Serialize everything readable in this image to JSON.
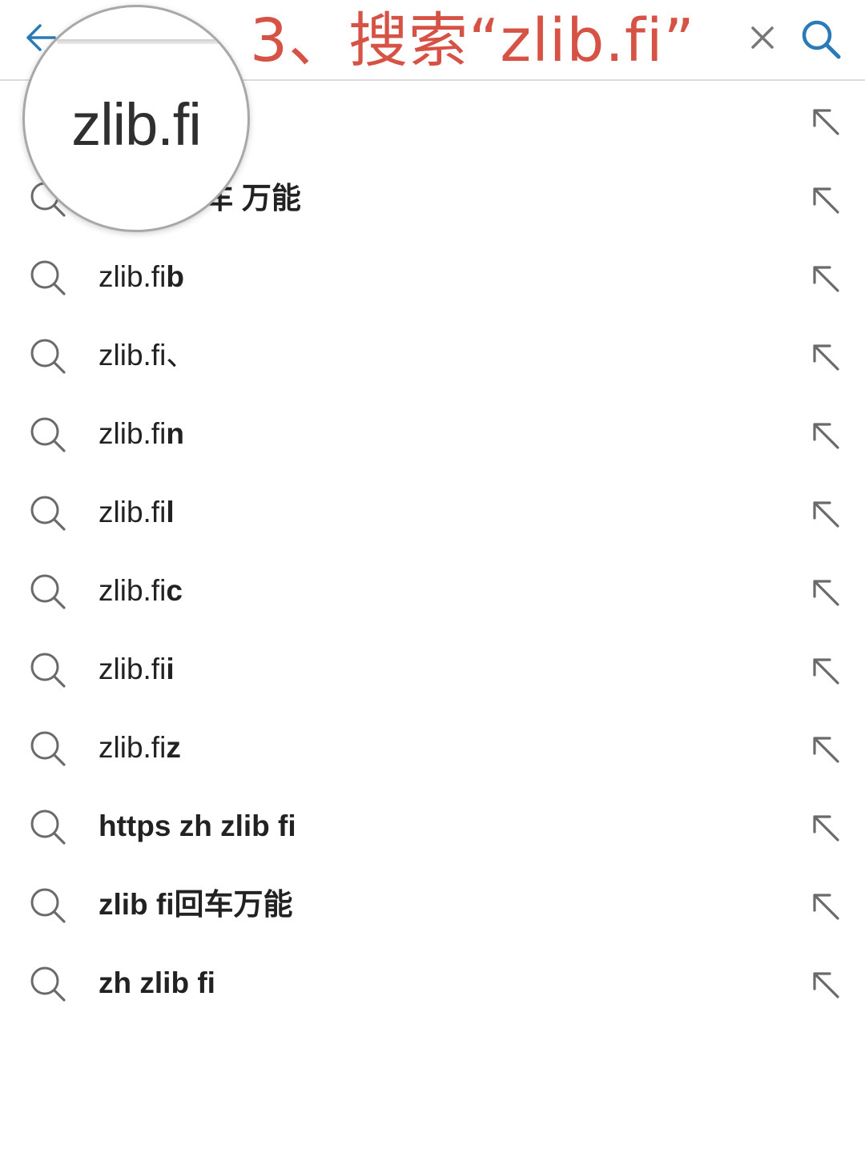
{
  "search": {
    "query": "zlib.fi",
    "instruction": "3、搜索“zlib.fi”"
  },
  "magnifier": {
    "text": "zlib.fi"
  },
  "suggestions": [
    {
      "typed": "zlib.fi",
      "completion": ""
    },
    {
      "typed": "",
      "completion": "zlib.fi回车 万能"
    },
    {
      "typed": "zlib.fi",
      "completion": "b"
    },
    {
      "typed": "zlib.fi、",
      "completion": ""
    },
    {
      "typed": "zlib.fi",
      "completion": "n"
    },
    {
      "typed": "zlib.fi",
      "completion": "l"
    },
    {
      "typed": "zlib.fi",
      "completion": "c"
    },
    {
      "typed": "zlib.fi",
      "completion": "i"
    },
    {
      "typed": "zlib.fi",
      "completion": "z"
    },
    {
      "typed": "",
      "completion": "https zh zlib fi"
    },
    {
      "typed": "",
      "completion": "zlib fi回车万能"
    },
    {
      "typed": "",
      "completion": "zh zlib fi"
    }
  ],
  "icons": {
    "back": "arrow-left-icon",
    "clear": "close-icon",
    "search": "search-icon",
    "suggestion": "search-icon",
    "fill": "arrow-up-left-icon"
  },
  "colors": {
    "accent": "#2a7ab8",
    "instruction": "#d65245",
    "icon_gray": "#666666",
    "divider": "#dcdcdc"
  }
}
